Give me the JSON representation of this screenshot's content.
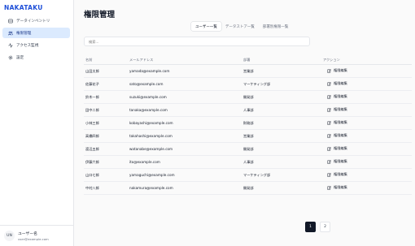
{
  "sidebar": {
    "brand": "NAKATAKU",
    "items": [
      {
        "label": "データインベントリ",
        "icon": "database-icon",
        "active": false
      },
      {
        "label": "権限管理",
        "icon": "users-icon",
        "active": true
      },
      {
        "label": "アクセス監視",
        "icon": "activity-icon",
        "active": false
      },
      {
        "label": "設定",
        "icon": "gear-icon",
        "active": false
      }
    ],
    "user": {
      "initials": "UN",
      "name": "ユーザー名",
      "email": "user@example.com"
    }
  },
  "main": {
    "title": "権限管理",
    "tabs": [
      {
        "label": "ユーザー一覧",
        "active": true
      },
      {
        "label": "データストア一覧",
        "active": false
      },
      {
        "label": "部署別権限一覧",
        "active": false
      }
    ],
    "search_placeholder": "検索...",
    "table": {
      "headers": [
        "名前",
        "メールアドレス",
        "部署",
        "アクション"
      ],
      "edit_label": "権限編集",
      "rows": [
        {
          "name": "山田太郎",
          "email": "yamada@example.com",
          "dept": "営業部"
        },
        {
          "name": "佐藤花子",
          "email": "sato@example.com",
          "dept": "マーケティング部"
        },
        {
          "name": "鈴木一郎",
          "email": "suzuki@example.com",
          "dept": "開発部"
        },
        {
          "name": "田中二郎",
          "email": "tanaka@example.com",
          "dept": "人事部"
        },
        {
          "name": "小林三郎",
          "email": "kobayashi@example.com",
          "dept": "財務部"
        },
        {
          "name": "高橋四郎",
          "email": "takahashi@example.com",
          "dept": "営業部"
        },
        {
          "name": "渡辺五郎",
          "email": "watanabe@example.com",
          "dept": "開発部"
        },
        {
          "name": "伊藤六郎",
          "email": "ito@example.com",
          "dept": "人事部"
        },
        {
          "name": "山口七郎",
          "email": "yamaguchi@example.com",
          "dept": "マーケティング部"
        },
        {
          "name": "中村八郎",
          "email": "nakamura@example.com",
          "dept": "開発部"
        }
      ]
    },
    "pagination": {
      "pages": [
        "1",
        "2"
      ],
      "current": "1"
    }
  },
  "colors": {
    "accent": "#1d4ed8",
    "active_bg": "#dbeafe",
    "page_active": "#111827"
  }
}
